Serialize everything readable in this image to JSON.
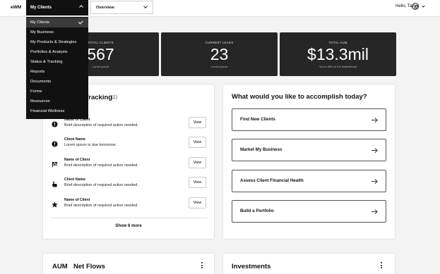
{
  "header": {
    "logo": "eWM",
    "client_menu_label": "My Clients",
    "view_select_value": "Overview",
    "greeting": "Hello, Taylor"
  },
  "client_menu": {
    "items": [
      {
        "label": "My Clients",
        "active": true
      },
      {
        "label": "My Business"
      },
      {
        "label": "My Products & Strategies"
      },
      {
        "label": "Portfolios & Analysis"
      },
      {
        "label": "Status & Tracking"
      },
      {
        "label": "Reports"
      },
      {
        "label": "Documents"
      },
      {
        "label": "Forms"
      },
      {
        "label": "Resources"
      },
      {
        "label": "Financial Wellness"
      }
    ]
  },
  "stats": {
    "total_clients": {
      "label": "TOTAL CLIENTS",
      "value": "567",
      "sub": "Lorem ipsum"
    },
    "current_leads": {
      "label": "CURRENT LEADS",
      "value": "23",
      "sub": "Lorem ipsum"
    },
    "total_aum": {
      "label": "TOTAL AUM",
      "value": "$13.3mil",
      "sub": "You're #58 on the leaderboard"
    }
  },
  "tracking": {
    "title": "Tracking",
    "count": "(11)",
    "items": [
      {
        "name": "Name of Client",
        "desc": "Brief description of required action needed.",
        "icon": "alert-circle-icon",
        "action": "View"
      },
      {
        "name": "Client Name",
        "desc": "Lorem ipsum is due tomorrow.",
        "icon": "alert-circle-icon",
        "action": "View"
      },
      {
        "name": "Name of Client",
        "desc": "Brief description of required action needed.",
        "icon": "flag-icon",
        "action": "View"
      },
      {
        "name": "Client Name",
        "desc": "Brief description of required action needed.",
        "icon": "pointer-hand-icon",
        "action": "View"
      },
      {
        "name": "Name of Client",
        "desc": "Brief description of required action needed.",
        "icon": "star-icon",
        "action": "View"
      }
    ],
    "show_more": "Show 6 more"
  },
  "accomplish": {
    "title": "What would you like to accomplish today?",
    "actions": [
      {
        "label": "Find New Clients"
      },
      {
        "label": "Market My Business"
      },
      {
        "label": "Assess Client Financial Health"
      },
      {
        "label": "Build a Portfolio"
      }
    ]
  },
  "bottom": {
    "aum_label": "AUM",
    "net_flows_label": "Net Flows",
    "investments_label": "Investments"
  }
}
